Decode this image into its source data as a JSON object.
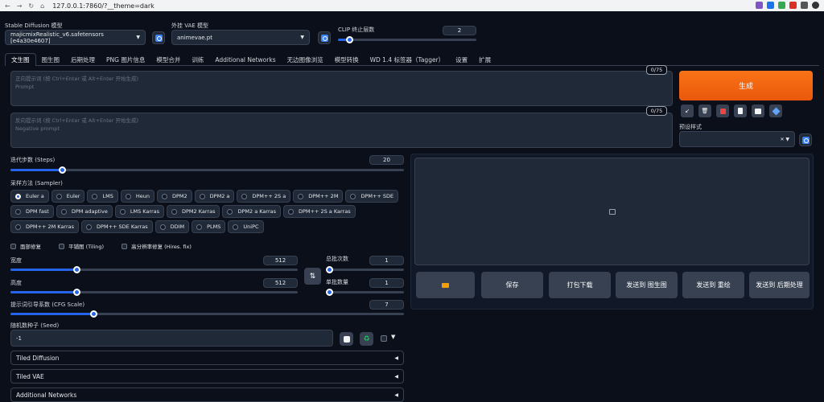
{
  "browser": {
    "url": "127.0.0.1:7860/?__theme=dark"
  },
  "top": {
    "sd_model_label": "Stable Diffusion 模型",
    "sd_model_value": "majicmixRealistic_v6.safetensors [e4a30e4607]",
    "vae_label": "外挂 VAE 模型",
    "vae_value": "animevae.pt",
    "clip_label": "CLIP 终止层数",
    "clip_value": "2"
  },
  "tabs": [
    "文生图",
    "图生图",
    "后期处理",
    "PNG 图片信息",
    "模型合并",
    "训练",
    "Additional Networks",
    "无边图像浏览",
    "模型转换",
    "WD 1.4 标签器（Tagger）",
    "设置",
    "扩展"
  ],
  "prompt": {
    "placeholder": "正向提示词 (按 Ctrl+Enter 或 Alt+Enter 开始生成)",
    "placeholder2": "Prompt",
    "counter": "0/75"
  },
  "negative": {
    "placeholder": "反向提示词 (按 Ctrl+Enter 或 Alt+Enter 开始生成)",
    "placeholder2": "Negative prompt",
    "counter": "0/75"
  },
  "generate_label": "生成",
  "styles_label": "预设样式",
  "steps": {
    "label": "迭代步数 (Steps)",
    "value": "20"
  },
  "sampler": {
    "label": "采样方法 (Sampler)",
    "row1": [
      "Euler a",
      "Euler",
      "LMS",
      "Heun",
      "DPM2",
      "DPM2 a",
      "DPM++ 2S a",
      "DPM++ 2M",
      "DPM++ SDE"
    ],
    "row2": [
      "DPM fast",
      "DPM adaptive",
      "LMS Karras",
      "DPM2 Karras",
      "DPM2 a Karras",
      "DPM++ 2S a Karras",
      "DPM++ 2M Karras"
    ],
    "row3": [
      "DPM++ SDE Karras",
      "DDIM",
      "PLMS",
      "UniPC"
    ]
  },
  "checks": {
    "face": "面部修复",
    "tiling": "平铺图 (Tiling)",
    "hires": "高分辨率修复 (Hires. fix)"
  },
  "width": {
    "label": "宽度",
    "value": "512"
  },
  "height": {
    "label": "高度",
    "value": "512"
  },
  "batch_count": {
    "label": "总批次数",
    "value": "1"
  },
  "batch_size": {
    "label": "单批数量",
    "value": "1"
  },
  "cfg": {
    "label": "提示词引导系数 (CFG Scale)",
    "value": "7"
  },
  "seed": {
    "label": "随机数种子 (Seed)",
    "value": "-1"
  },
  "accordions": [
    "Tiled Diffusion",
    "Tiled VAE",
    "Additional Networks"
  ],
  "output_buttons": [
    "保存",
    "打包下载",
    "发送到 图生图",
    "发送到 重绘",
    "发送到 后期处理"
  ]
}
